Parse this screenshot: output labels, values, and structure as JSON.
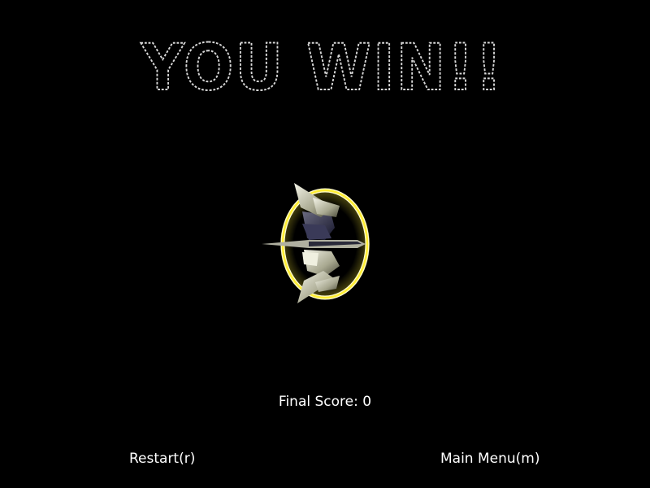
{
  "title": "YOU WIN!!",
  "final_score": {
    "label": "Final Score:",
    "value": "0"
  },
  "buttons": {
    "restart": "Restart(r)",
    "main_menu": "Main Menu(m)"
  },
  "colors": {
    "background": "#000000",
    "text": "#ffffff",
    "title_outline": "#d8d8d8",
    "ring": "#ffee33"
  }
}
